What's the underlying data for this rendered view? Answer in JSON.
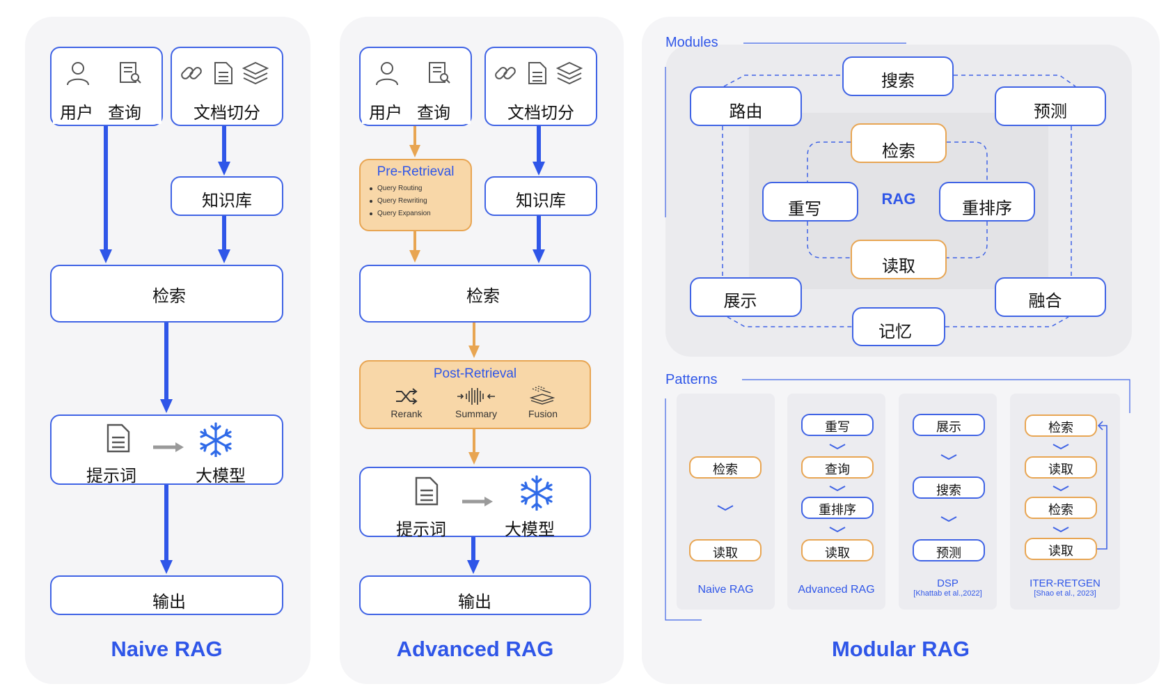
{
  "naive": {
    "title": "Naive RAG",
    "user": "用户",
    "query": "查询",
    "docs": "文档切分",
    "kb": "知识库",
    "retrieve": "检索",
    "prompt": "提示词",
    "llm": "大模型",
    "output": "输出"
  },
  "advanced": {
    "title": "Advanced RAG",
    "user": "用户",
    "query": "查询",
    "docs": "文档切分",
    "kb": "知识库",
    "pre_title": "Pre-Retrieval",
    "pre_items": [
      "Query Routing",
      "Query Rewriting",
      "Query Expansion"
    ],
    "retrieve": "检索",
    "post_title": "Post-Retrieval",
    "post_items": [
      "Rerank",
      "Summary",
      "Fusion"
    ],
    "prompt": "提示词",
    "llm": "大模型",
    "output": "输出"
  },
  "modular": {
    "title": "Modular RAG",
    "modules_label": "Modules",
    "patterns_label": "Patterns",
    "center": "RAG",
    "outer": {
      "search": "搜索",
      "route": "路由",
      "predict": "预测",
      "demonstrate": "展示",
      "fusion": "融合",
      "memory": "记忆"
    },
    "inner": {
      "retrieve": "检索",
      "rewrite": "重写",
      "rerank": "重排序",
      "read": "读取"
    },
    "patterns": [
      {
        "name": "Naive RAG",
        "cite": "",
        "steps": [
          "检索",
          "读取"
        ]
      },
      {
        "name": "Advanced RAG",
        "cite": "",
        "steps": [
          "重写",
          "查询",
          "重排序",
          "读取"
        ]
      },
      {
        "name": "DSP",
        "cite": "[Khattab et al.,2022]",
        "steps": [
          "展示",
          "搜索",
          "预测"
        ]
      },
      {
        "name": "ITER-RETGEN",
        "cite": "[Shao et al., 2023]",
        "steps": [
          "检索",
          "读取",
          "检索",
          "读取"
        ]
      }
    ]
  },
  "colors": {
    "blue": "#3f63e5",
    "orange": "#e8a552",
    "orange_fill": "#f8d7a8",
    "panel": "#f5f5f7"
  }
}
